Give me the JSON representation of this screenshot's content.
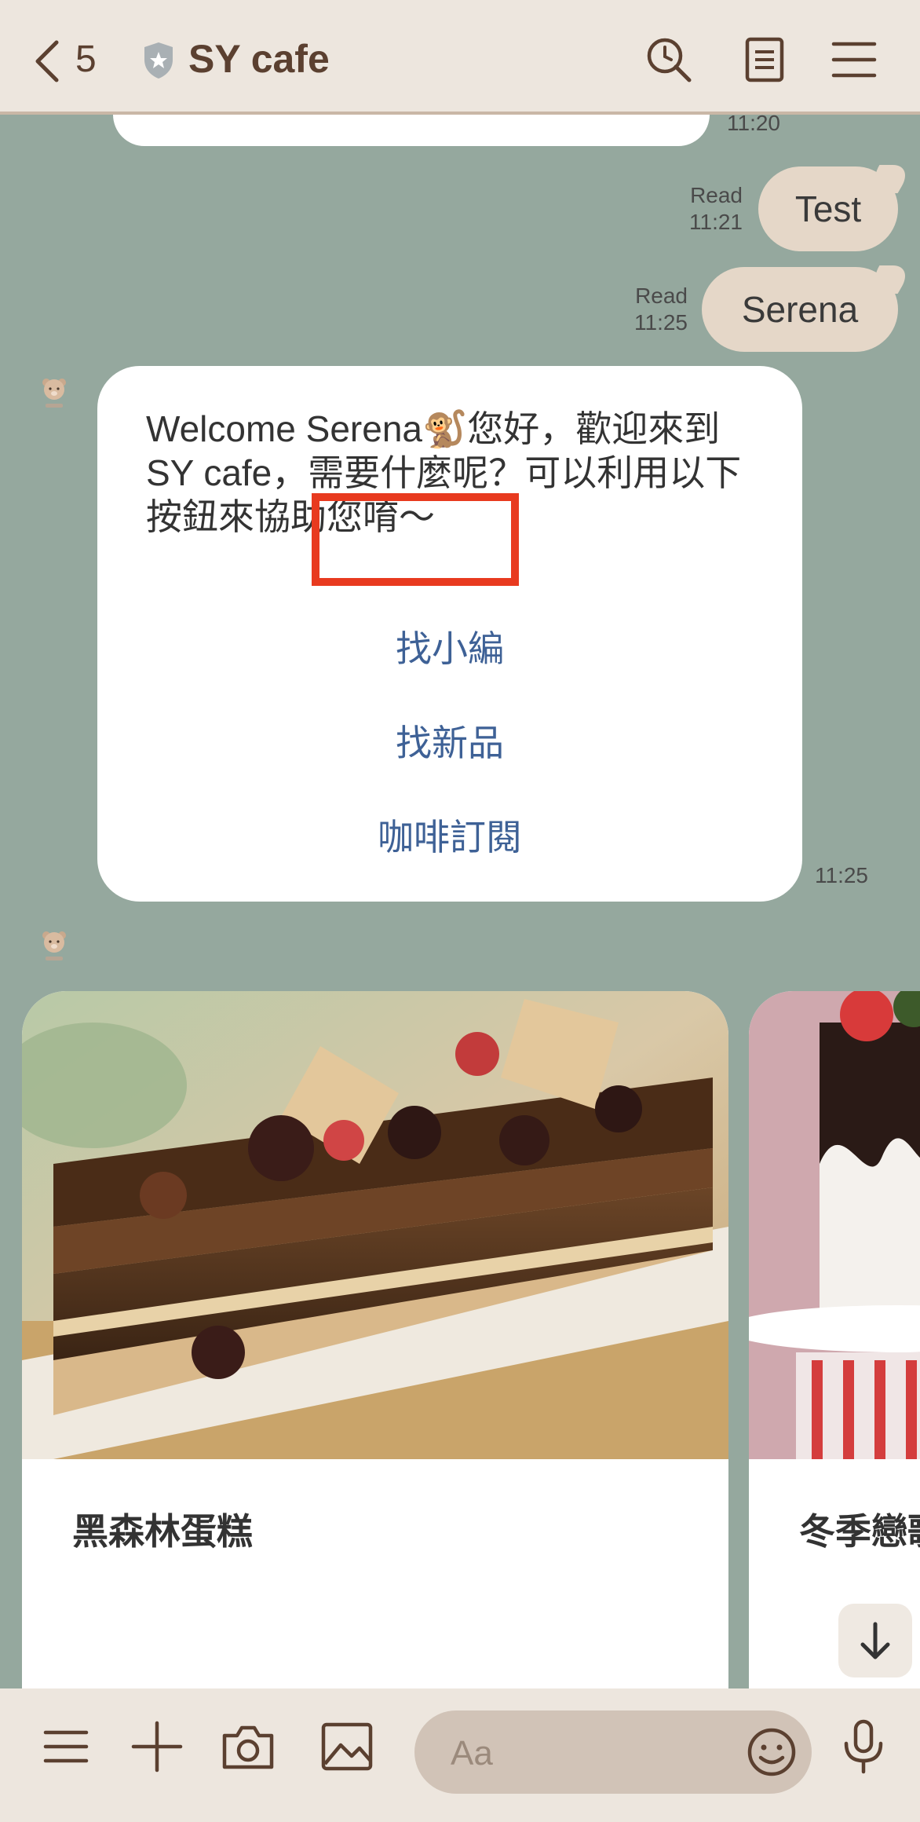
{
  "header": {
    "back_count": "5",
    "title": "SY cafe",
    "icons": [
      "chevron-left-icon",
      "shield-icon",
      "search-icon",
      "notes-icon",
      "menu-icon"
    ]
  },
  "messages": {
    "top_partial_time": "11:20",
    "outgoing": [
      {
        "text": "Test",
        "status": "Read",
        "time": "11:21"
      },
      {
        "text": "Serena",
        "status": "Read",
        "time": "11:25"
      }
    ],
    "welcome_card": {
      "text": "Welcome  Serena🐒您好，歡迎來到SY cafe，需要什麼呢？可以利用以下按鈕來協助您唷～",
      "actions": [
        "找小編",
        "找新品",
        "咖啡訂閱"
      ],
      "time": "11:25"
    },
    "carousel": [
      {
        "name": "黑森林蛋糕"
      },
      {
        "name": "冬季戀歌"
      }
    ]
  },
  "composer": {
    "placeholder": "Aa",
    "icons": [
      "menu-icon",
      "plus-icon",
      "camera-icon",
      "image-icon",
      "emoji-icon",
      "microphone-icon"
    ]
  },
  "colors": {
    "chat_bg": "#95a89e",
    "bar_bg": "#ede6de",
    "outgoing_bubble": "#e5d7c8",
    "action_link": "#3e6196",
    "highlight": "#e83a1f"
  }
}
